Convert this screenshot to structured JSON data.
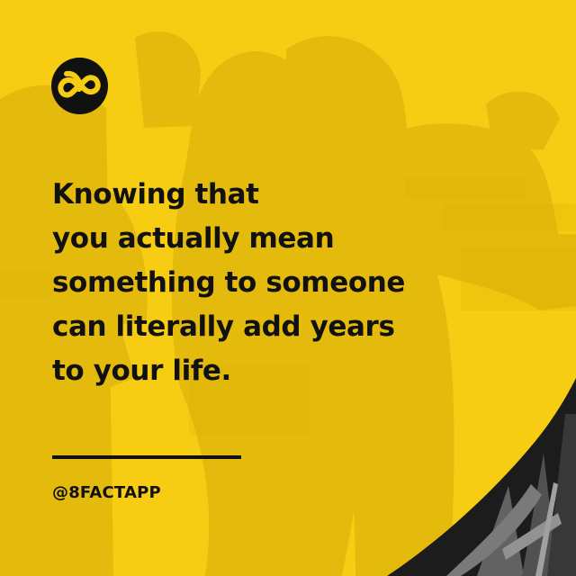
{
  "brand": {
    "logo_icon": "infinity-8-logo-icon",
    "handle": "@8FACTAPP"
  },
  "fact": {
    "lines": [
      "Knowing that",
      "you actually mean",
      "something to someone",
      "can literally add years",
      "to your life."
    ]
  },
  "colors": {
    "background_yellow": "#f6cd12",
    "text": "#111111",
    "photo_shadow": "#c9a40d"
  }
}
